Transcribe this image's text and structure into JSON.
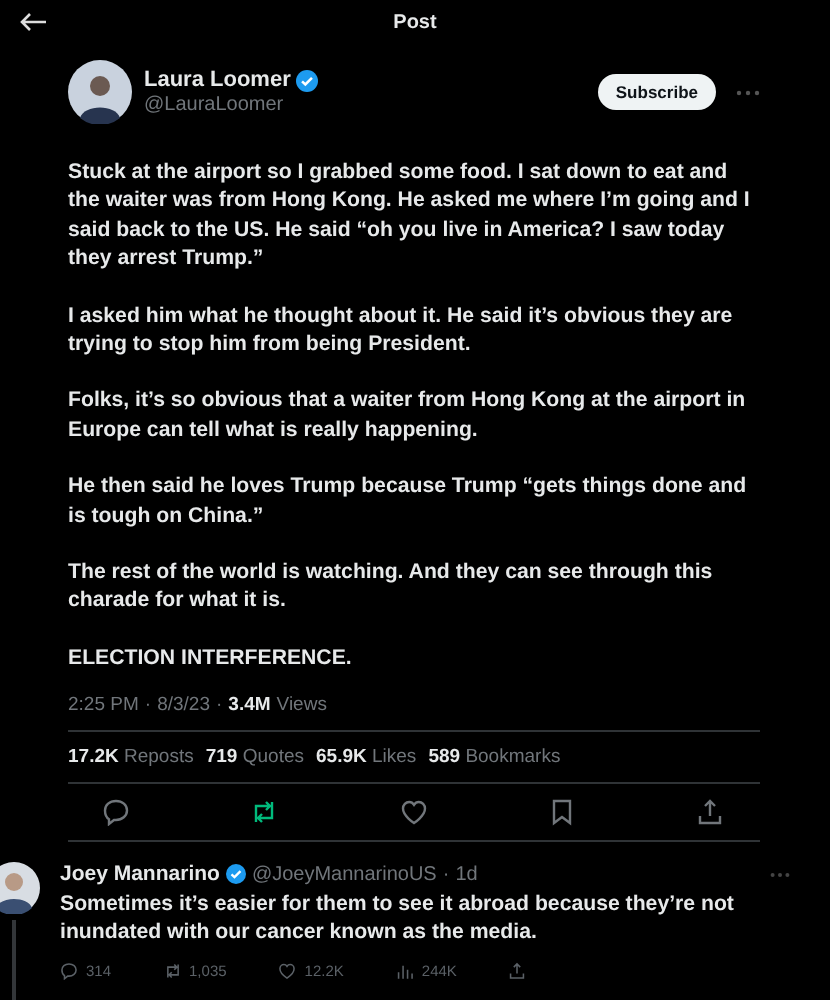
{
  "header": {
    "title": "Post"
  },
  "post": {
    "author": {
      "name": "Laura Loomer",
      "verified": true,
      "handle": "@LauraLoomer"
    },
    "subscribe_label": "Subscribe",
    "paragraphs": [
      "Stuck at the airport so I grabbed some food. I sat down to eat and the waiter was from Hong Kong. He asked me where I’m going and I said back to the US. He said “oh you live in America? I saw today they arrest Trump.”",
      "I asked him what he thought about it. He said it’s obvious they are trying to stop him from being President.",
      "Folks, it’s so obvious that a waiter from Hong Kong at the airport in Europe can tell what is really happening.",
      "He then said he loves Trump because Trump “gets things done and is tough on China.”",
      "The rest of the world is watching. And they can see through this charade for what it is.",
      "ELECTION INTERFERENCE."
    ],
    "time": "2:25 PM",
    "separator": "·",
    "date": "8/3/23",
    "views": "3.4M",
    "views_label": "Views",
    "stats": [
      {
        "count": "17.2K",
        "label": "Reposts"
      },
      {
        "count": "719",
        "label": "Quotes"
      },
      {
        "count": "65.9K",
        "label": "Likes"
      },
      {
        "count": "589",
        "label": "Bookmarks"
      }
    ],
    "actions": [
      {
        "kind": "reply",
        "active": false
      },
      {
        "kind": "repost",
        "active": true
      },
      {
        "kind": "like",
        "active": false
      },
      {
        "kind": "bookmark",
        "active": false
      },
      {
        "kind": "share",
        "active": false
      }
    ]
  },
  "reply": {
    "author": {
      "name": "Joey Mannarino",
      "verified": true,
      "handle": "@JoeyMannarinoUS",
      "age": "1d"
    },
    "text": "Sometimes it’s easier for them to see it abroad because they’re not inundated with our cancer known as the media.",
    "actions": [
      {
        "kind": "reply",
        "count": "314"
      },
      {
        "kind": "repost",
        "count": "1,035"
      },
      {
        "kind": "like",
        "count": "12.2K"
      },
      {
        "kind": "views",
        "count": "244K"
      },
      {
        "kind": "share"
      }
    ]
  }
}
